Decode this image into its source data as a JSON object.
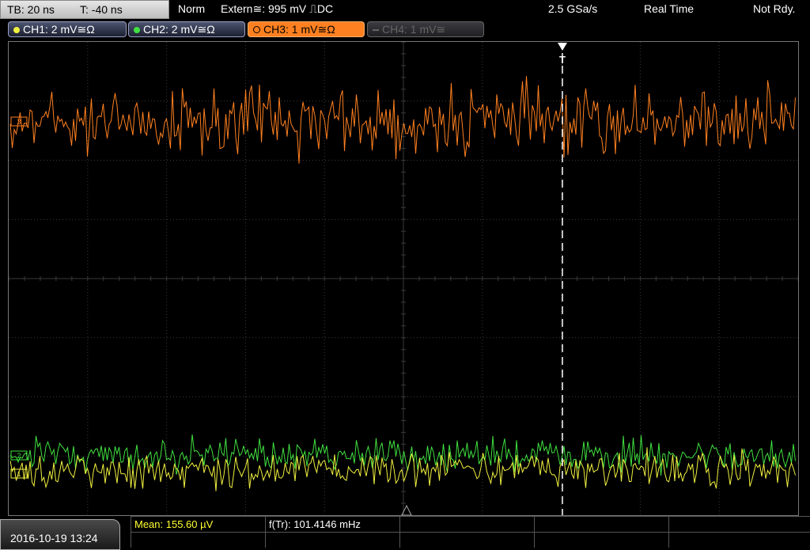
{
  "header": {
    "timebase": "TB: 20 ns",
    "trigger_time": "T: -40 ns",
    "trigger_mode": "Norm",
    "trigger_source": "Extern≅: 995 mV ⎍DC",
    "sample_rate": "2.5 GSa/s",
    "acq_mode": "Real Time",
    "status": "Not Rdy."
  },
  "channels": [
    {
      "id": "ch1",
      "label": "CH1: 2 mV≅Ω",
      "color": "#f0f040"
    },
    {
      "id": "ch2",
      "label": "CH2: 2 mV≅Ω",
      "color": "#40e040"
    },
    {
      "id": "ch3",
      "label": "CH3: 1 mV≅Ω",
      "color": "#ff8020"
    },
    {
      "id": "ch4",
      "label": "CH4: 1 mV≅",
      "color": "#606060"
    }
  ],
  "markers": {
    "ch3": "3",
    "ch2": "2",
    "ch1": "1",
    "trigger": "T"
  },
  "footer": {
    "datetime": "2016-10-19 13:24",
    "mean": "Mean: 155.60 µV",
    "freq": "f(Tr): 101.4146 mHz"
  },
  "colors": {
    "grid": "#3a3a3a",
    "trigger_line": "#ffffff"
  }
}
